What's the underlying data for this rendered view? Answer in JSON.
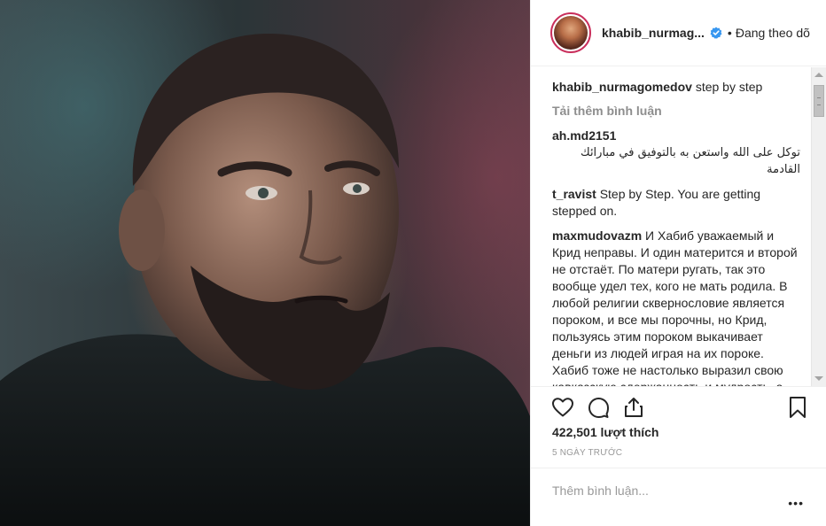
{
  "post": {
    "image_alt": "Khabib Nurmagomedov portrait",
    "header": {
      "username": "khabib_nurmag...",
      "separator": "•",
      "follow_status": "Đang theo dõ"
    },
    "caption": {
      "user": "khabib_nurmagomedov",
      "text": "step by step"
    },
    "load_more": "Tải thêm bình luận",
    "comments": [
      {
        "user": "ah.md2151",
        "text": "توكل على الله واستعن به بالتوفيق في مبارائك القادمة"
      },
      {
        "user": "t_ravist",
        "text": "Step by Step. You are getting stepped on."
      },
      {
        "user": "maxmudovazm",
        "text": "И Хабиб уважаемый и Крид неправы. И один матерится и второй не отстаёт. По матери ругать, так это вообще удел тех, кого не мать родила. В любой религии сквернословие является пороком, и все мы порочны, но Крид, пользуясь этим пороком выкачивает деньги из людей играя на их пороке. Хабиб тоже не настолько выразил свою кавказскую сдержанность и мудрость, а поддался соблазну выставить порок сквернословия на"
      }
    ],
    "likes": "422,501 lượt thích",
    "timestamp": "5 ngày trước",
    "add_comment_placeholder": "Thêm bình luận...",
    "more_label": "•••",
    "icons": {
      "like": "heart-icon",
      "comment": "comment-bubble-icon",
      "share": "share-icon",
      "save": "bookmark-icon",
      "verified": "verified-badge-icon"
    },
    "colors": {
      "avatar_ring": "#c92e5b",
      "verified": "#3897f0",
      "muted": "#999999"
    }
  }
}
